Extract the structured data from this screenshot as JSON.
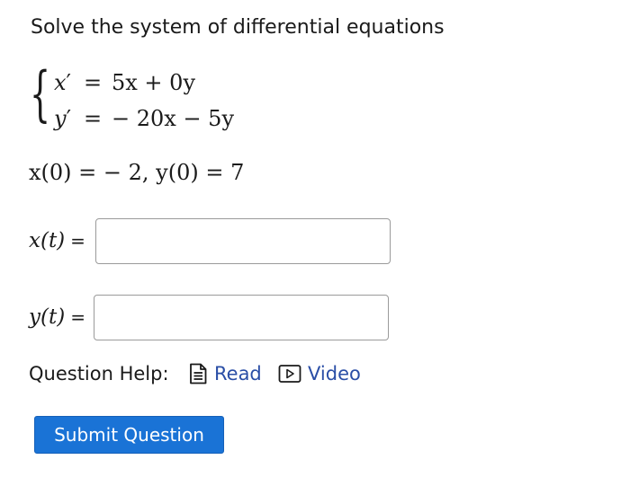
{
  "prompt": "Solve the system of differential equations",
  "system": {
    "eq1": {
      "lhs_var": "x",
      "prime": "′",
      "eq": "=",
      "rhs": "5x + 0y"
    },
    "eq2": {
      "lhs_var": "y",
      "prime": "′",
      "eq": "=",
      "rhs": "− 20x − 5y"
    }
  },
  "initial_conditions": "x(0)  =  − 2,  y(0) = 7",
  "answers": {
    "x_label": "x(t)",
    "y_label": "y(t)",
    "equals": "=",
    "x_value": "",
    "y_value": ""
  },
  "help": {
    "label": "Question Help:",
    "read_label": "Read",
    "video_label": "Video",
    "read_icon": "document-icon",
    "video_icon": "play-video-icon",
    "link_color": "#2a4ea6"
  },
  "submit": {
    "label": "Submit Question",
    "color": "#1a73d6"
  }
}
